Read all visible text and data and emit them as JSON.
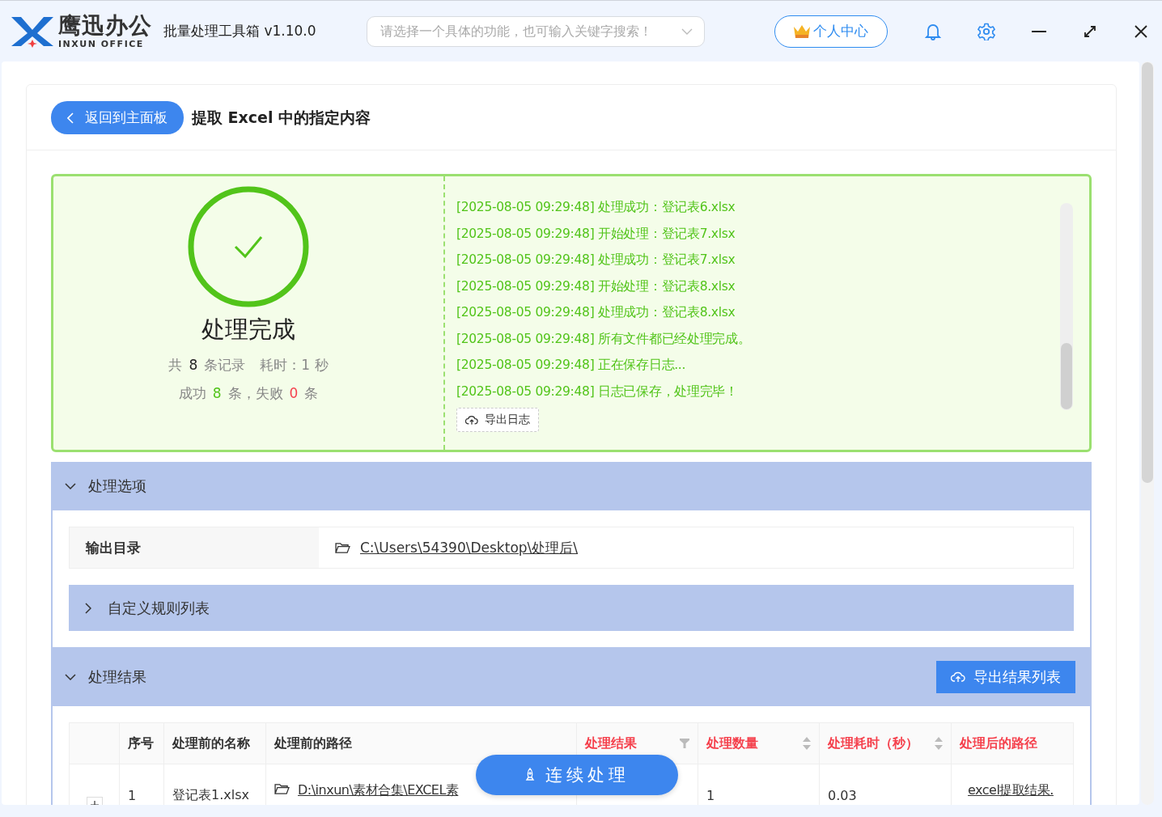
{
  "header": {
    "logo_name": "鹰迅办公",
    "logo_sub": "INXUN OFFICE",
    "app_title": "批量处理工具箱 v1.10.0",
    "search": {
      "placeholder": "请选择一个具体的功能，也可输入关键字搜索！"
    },
    "user_button": "个人中心"
  },
  "page": {
    "back_button": "返回到主面板",
    "title": "提取 Excel 中的指定内容"
  },
  "summary": {
    "status": "处理完成",
    "total_prefix": "共",
    "total": "8",
    "total_suffix": "条记录",
    "time": "耗时：1 秒",
    "success_prefix": "成功",
    "success": "8",
    "middle": "条，失败",
    "fail": "0",
    "fail_suffix": "条",
    "log": [
      "[2025-08-05 09:29:48] 处理成功：登记表6.xlsx",
      "[2025-08-05 09:29:48] 开始处理：登记表7.xlsx",
      "[2025-08-05 09:29:48] 处理成功：登记表7.xlsx",
      "[2025-08-05 09:29:48] 开始处理：登记表8.xlsx",
      "[2025-08-05 09:29:48] 处理成功：登记表8.xlsx",
      "[2025-08-05 09:29:48] 所有文件都已经处理完成。",
      "[2025-08-05 09:29:48] 正在保存日志...",
      "[2025-08-05 09:29:48] 日志已保存，处理完毕！"
    ],
    "export_log_button": "导出日志"
  },
  "options": {
    "title": "处理选项",
    "expanded": true,
    "output_label": "输出目录",
    "output_path": "C:\\Users\\54390\\Desktop\\处理后\\",
    "rules": {
      "title": "自定义规则列表",
      "expanded": false
    }
  },
  "results": {
    "title": "处理结果",
    "expanded": true,
    "export_button": "导出结果列表",
    "columns": [
      {
        "label": "序号",
        "highlight": false,
        "kind": "plain"
      },
      {
        "label": "处理前的名称",
        "highlight": false,
        "kind": "plain"
      },
      {
        "label": "处理前的路径",
        "highlight": false,
        "kind": "plain"
      },
      {
        "label": "处理结果",
        "highlight": true,
        "kind": "filter"
      },
      {
        "label": "处理数量",
        "highlight": true,
        "kind": "sort"
      },
      {
        "label": "处理耗时（秒）",
        "highlight": true,
        "kind": "sort"
      },
      {
        "label": "处理后的路径",
        "highlight": true,
        "kind": "plain"
      }
    ],
    "rows": [
      {
        "expanded": false,
        "index": "1",
        "name": "登记表1.xlsx",
        "path": "D:\\inxun\\素材合集\\EXCEL素",
        "count": "1",
        "time": "0.03",
        "output": "excel提取结果."
      }
    ]
  },
  "float_button": "连续处理"
}
